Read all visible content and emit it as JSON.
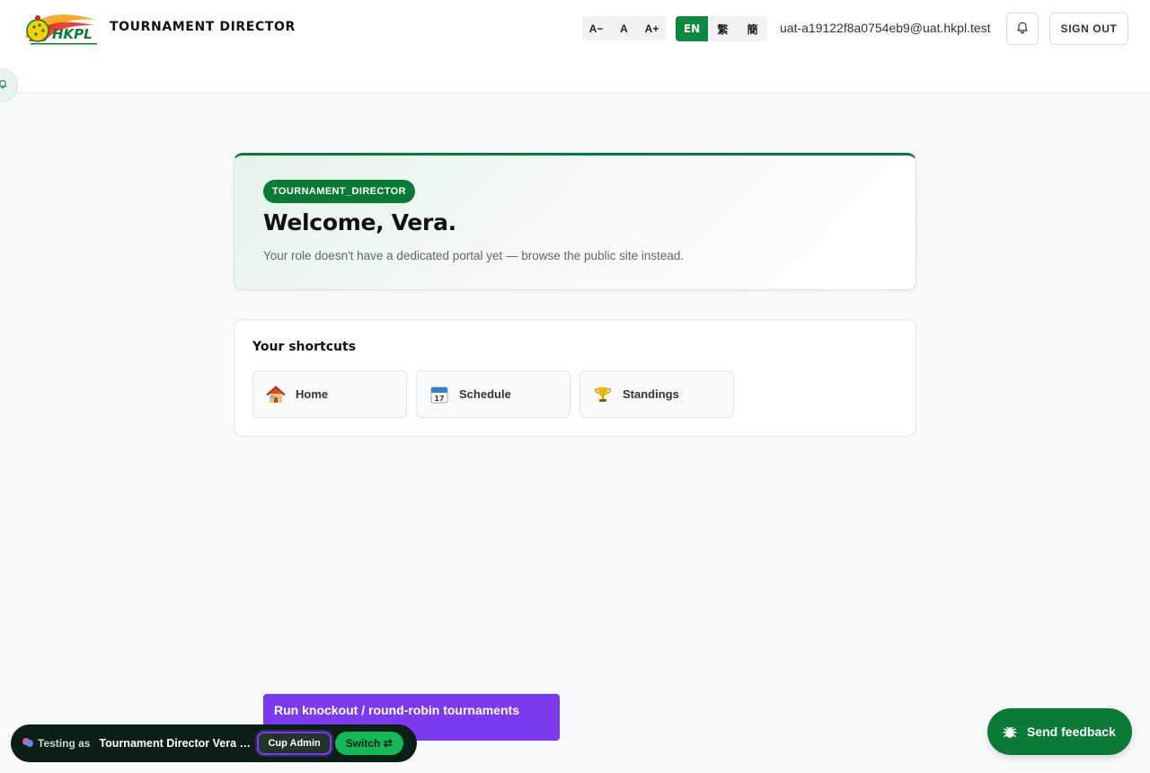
{
  "header": {
    "logo_text": "HKPL",
    "title": "TOURNAMENT DIRECTOR",
    "font_size": [
      "A−",
      "A",
      "A+"
    ],
    "languages": [
      {
        "label": "EN",
        "active": true
      },
      {
        "label": "繁",
        "active": false
      },
      {
        "label": "簡",
        "active": false
      }
    ],
    "user_email": "uat-a19122f8a0754eb9@uat.hkpl.test",
    "sign_out": "SIGN OUT"
  },
  "welcome": {
    "role_badge": "TOURNAMENT_DIRECTOR",
    "title": "Welcome, Vera.",
    "subtitle": "Your role doesn't have a dedicated portal yet — browse the public site instead."
  },
  "shortcuts": {
    "title": "Your shortcuts",
    "items": [
      {
        "label": "Home",
        "icon": "house-icon"
      },
      {
        "label": "Schedule",
        "icon": "calendar-icon"
      },
      {
        "label": "Standings",
        "icon": "trophy-icon"
      }
    ]
  },
  "testing_bar": {
    "label": "Testing as",
    "name": "Tournament Director Vera Testing",
    "role_chip": "Cup Admin",
    "switch": "Switch ⇄"
  },
  "tooltip": {
    "text": "Run knockout / round-robin tournaments"
  },
  "feedback": {
    "label": "Send feedback"
  },
  "colors": {
    "brand_green": "#0b7a36",
    "active_lang": "#0b8a3e",
    "tooltip_purple": "#7c3aed",
    "testing_bar_bg": "#0c1f17"
  }
}
